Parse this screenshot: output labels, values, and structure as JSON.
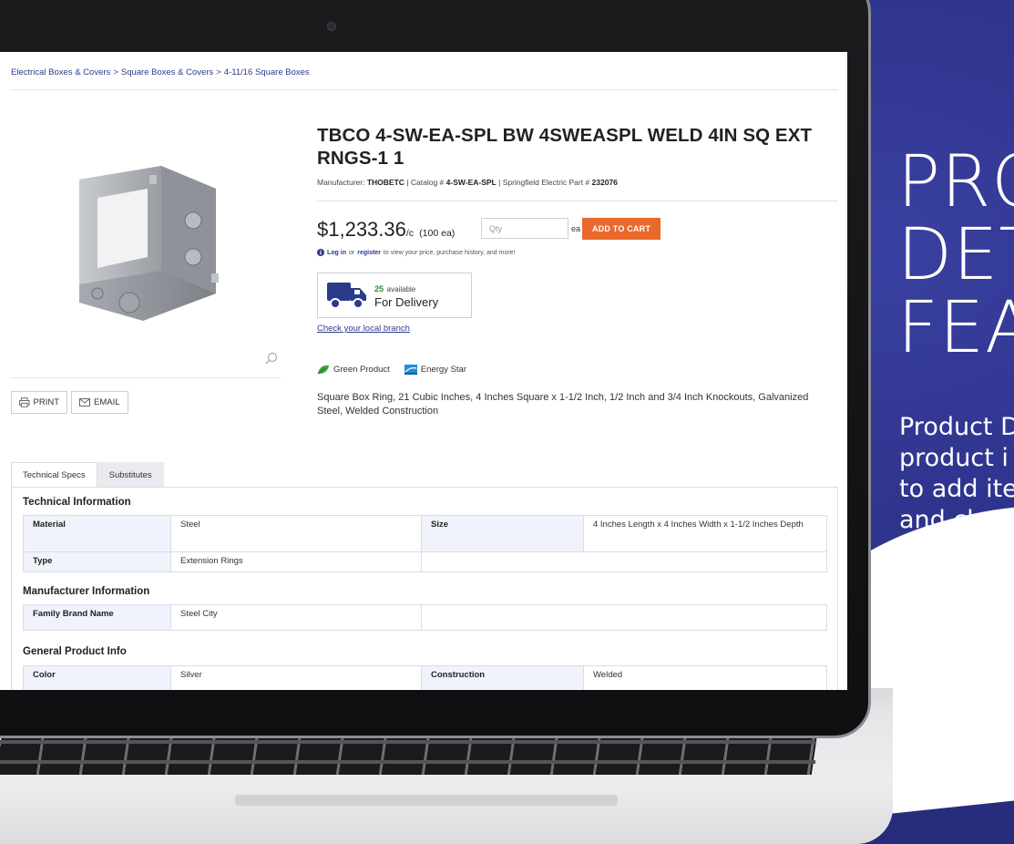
{
  "promo": {
    "heading_line1": "PRO",
    "heading_line2": "DET",
    "heading_line3": "FEA",
    "sub_line1": "Product D",
    "sub_line2": "product i",
    "sub_line3": "to add ite",
    "sub_line4": "and chec"
  },
  "breadcrumb": {
    "item1": "Electrical Boxes & Covers",
    "item2": "Square Boxes & Covers",
    "item3": "4-11/16 Square Boxes",
    "separator": ">"
  },
  "product": {
    "title": "TBCO 4-SW-EA-SPL BW 4SWEASPL WELD 4IN SQ EXT RNGS-1 1",
    "manufacturer_label": "Manufacturer:",
    "manufacturer": "THOBETC",
    "catalog_label": "Catalog #",
    "catalog": "4-SW-EA-SPL",
    "part_label": "Springfield Electric Part #",
    "part": "232076",
    "divider": "|",
    "price": "$1,233.36",
    "price_unit": "/c",
    "price_qty": "(100 ea)",
    "qty_placeholder": "Qty",
    "qty_unit": "ea",
    "add_to_cart": "ADD TO CART",
    "login_link": "Log in",
    "login_or": "or",
    "register_link": "register",
    "login_rest": "to view your price, purchase history, and more!",
    "available_count": "25",
    "available_word": "available",
    "delivery_label": "For Delivery",
    "branch_link": "Check your local branch",
    "green_badge": "Green Product",
    "energy_badge": "Energy Star",
    "description": "Square Box Ring, 21 Cubic Inches, 4 Inches Square x 1-1/2 Inch, 1/2 Inch and 3/4 Inch Knockouts, Galvanized Steel, Welded Construction",
    "print_label": "PRINT",
    "email_label": "EMAIL"
  },
  "tabs": {
    "tech_specs": "Technical Specs",
    "substitutes": "Substitutes"
  },
  "specs": {
    "technical_title": "Technical Information",
    "material_label": "Material",
    "material_value": "Steel",
    "size_label": "Size",
    "size_value": "4 Inches Length x 4 Inches Width x 1-1/2 Inches Depth",
    "type_label": "Type",
    "type_value": "Extension Rings",
    "manufacturer_title": "Manufacturer Information",
    "family_label": "Family Brand Name",
    "family_value": "Steel City",
    "general_title": "General Product Info",
    "color_label": "Color",
    "color_value": "Silver",
    "construction_label": "Construction",
    "construction_value": "Welded"
  },
  "colors": {
    "brand_navy": "#2b3186",
    "cart_orange": "#e8692b",
    "link_blue": "#2b3b8c",
    "available_green": "#2e8b3a"
  },
  "icons": {
    "print": "printer-icon",
    "email": "envelope-icon",
    "zoom": "magnifier-icon",
    "truck": "delivery-truck-icon",
    "info": "info-icon",
    "leaf": "leaf-icon",
    "energy": "energy-star-icon"
  }
}
